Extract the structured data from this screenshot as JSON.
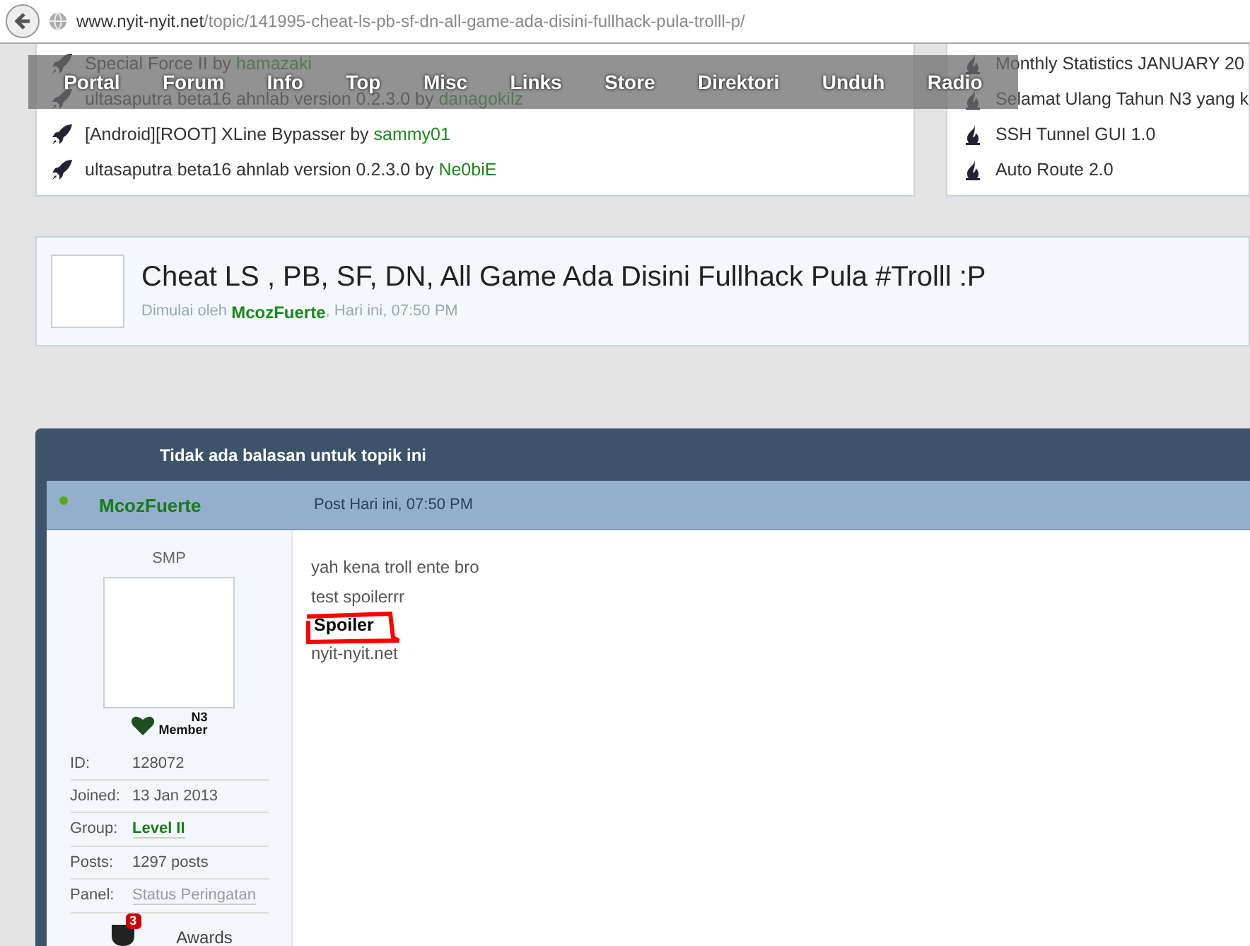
{
  "browser": {
    "url_host": "www.nyit-nyit.net",
    "url_path": "/topic/141995-cheat-ls-pb-sf-dn-all-game-ada-disini-fullhack-pula-trolll-p/"
  },
  "nav": [
    "Portal",
    "Forum",
    "Info",
    "Top",
    "Misc",
    "Links",
    "Store",
    "Direktori",
    "Unduh",
    "Radio"
  ],
  "recent_topics": [
    {
      "title": "Special Force II",
      "by": "by",
      "author": "hamazaki"
    },
    {
      "title": "ultasaputra beta16 ahnlab version 0.2.3.0",
      "by": "by",
      "author": "danagokilz"
    },
    {
      "title": "[Android][ROOT] XLine Bypasser",
      "by": "by",
      "author": "sammy01"
    },
    {
      "title": "ultasaputra beta16 ahnlab version 0.2.3.0",
      "by": "by",
      "author": "Ne0biE"
    }
  ],
  "recent_files": [
    "Monthly Statistics JANUARY 20",
    "Selamat Ulang Tahun N3 yang k",
    "SSH Tunnel GUI 1.0",
    "Auto Route 2.0"
  ],
  "topic": {
    "title": "Cheat LS , PB, SF, DN, All Game Ada Disini Fullhack Pula #Trolll :P",
    "started_label": "Dimulai oleh",
    "author": "McozFuerte",
    "time": ", Hari ini, 07:50 PM"
  },
  "post_box": {
    "header": "Tidak ada balasan untuk topik ini",
    "author": "McozFuerte",
    "online": true,
    "post_time": "Post Hari ini, 07:50 PM",
    "rank": "SMP",
    "badge": {
      "line1": "N3",
      "line2": "Member"
    },
    "fields": [
      {
        "label": "ID:",
        "value": "128072",
        "kind": "plain"
      },
      {
        "label": "Joined:",
        "value": "13 Jan 2013",
        "kind": "plain"
      },
      {
        "label": "Group:",
        "value": "Level II",
        "kind": "group"
      },
      {
        "label": "Posts:",
        "value": "1297 posts",
        "kind": "plain"
      },
      {
        "label": "Panel:",
        "value": "Status Peringatan",
        "kind": "link"
      }
    ],
    "awards": {
      "count": "3",
      "label": "Awards"
    },
    "body": [
      {
        "kind": "text",
        "text": "yah kena troll ente bro"
      },
      {
        "kind": "text",
        "text": "test spoilerrr"
      },
      {
        "kind": "spoiler",
        "text": "Spoiler"
      },
      {
        "kind": "text",
        "text": "nyit-nyit.net"
      }
    ]
  }
}
